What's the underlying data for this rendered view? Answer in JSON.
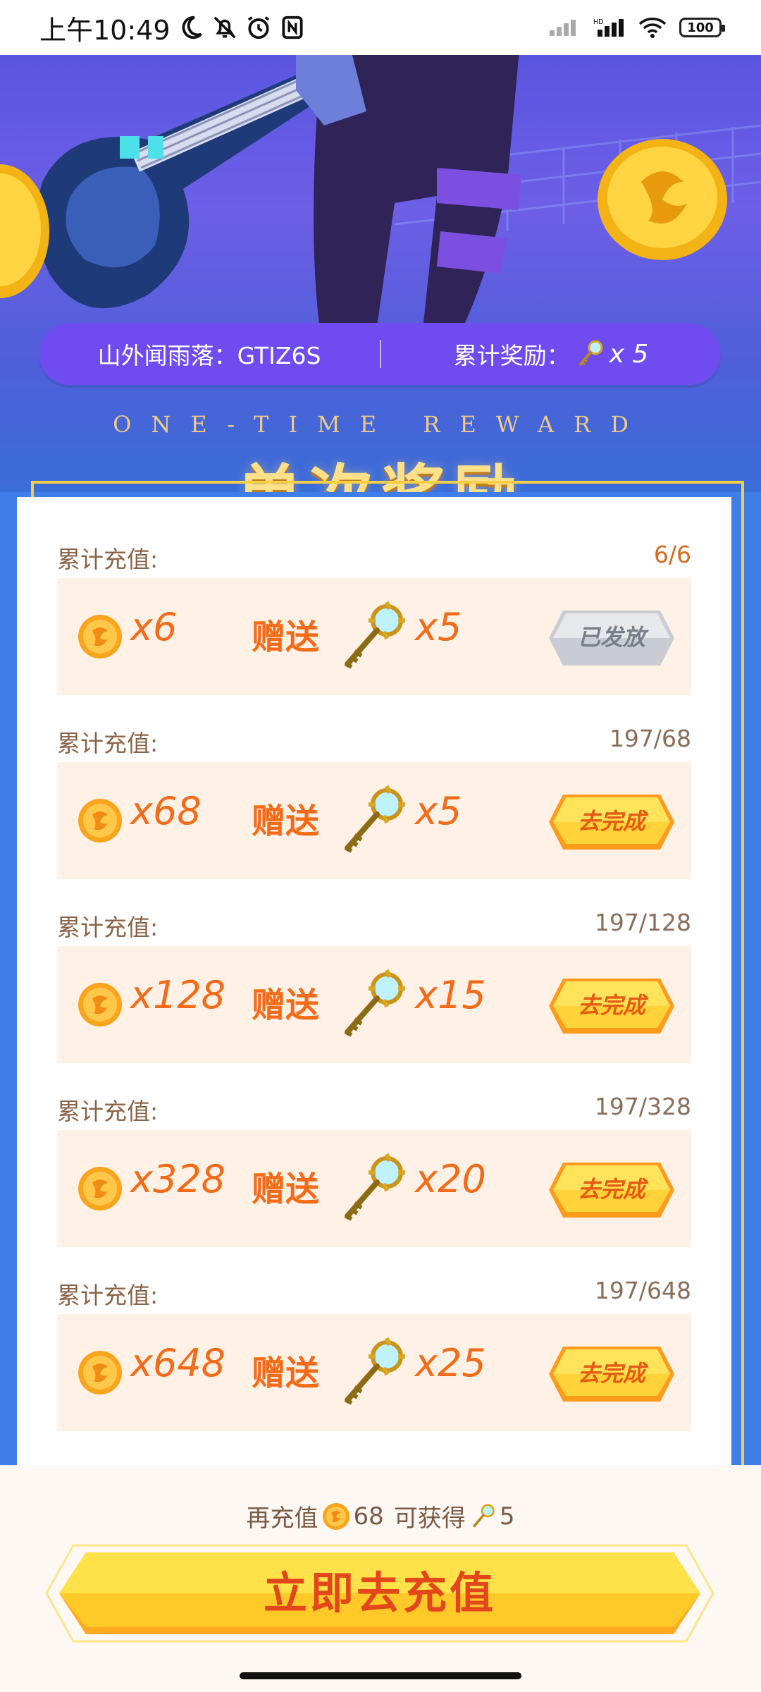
{
  "status_bar": {
    "time": "上午10:49",
    "battery": "100"
  },
  "header": {
    "user_label": "山外闻雨落：GTIZ6S",
    "reward_label": "累计奖励：",
    "reward_multiplier": "x 5",
    "subtitle_en": "ONE-TIME REWARD",
    "title": "单次奖励"
  },
  "rewards": [
    {
      "label": "累计充值:",
      "progress": "6/6",
      "coins": "x6",
      "gift": "赠送",
      "keys": "x5",
      "button": "已发放",
      "status": "done"
    },
    {
      "label": "累计充值:",
      "progress": "197/68",
      "coins": "x68",
      "gift": "赠送",
      "keys": "x5",
      "button": "去完成",
      "status": "todo"
    },
    {
      "label": "累计充值:",
      "progress": "197/128",
      "coins": "x128",
      "gift": "赠送",
      "keys": "x15",
      "button": "去完成",
      "status": "todo"
    },
    {
      "label": "累计充值:",
      "progress": "197/328",
      "coins": "x328",
      "gift": "赠送",
      "keys": "x20",
      "button": "去完成",
      "status": "todo"
    },
    {
      "label": "累计充值:",
      "progress": "197/648",
      "coins": "x648",
      "gift": "赠送",
      "keys": "x25",
      "button": "去完成",
      "status": "todo"
    }
  ],
  "footer": {
    "hint_prefix": "再充值",
    "hint_amount": "68",
    "hint_middle": "可获得",
    "hint_keys": "5",
    "cta_label": "立即去充值"
  },
  "colors": {
    "accent_orange": "#f36b19",
    "pill_purple": "#6e4cf0",
    "gold": "#f6cf45"
  }
}
